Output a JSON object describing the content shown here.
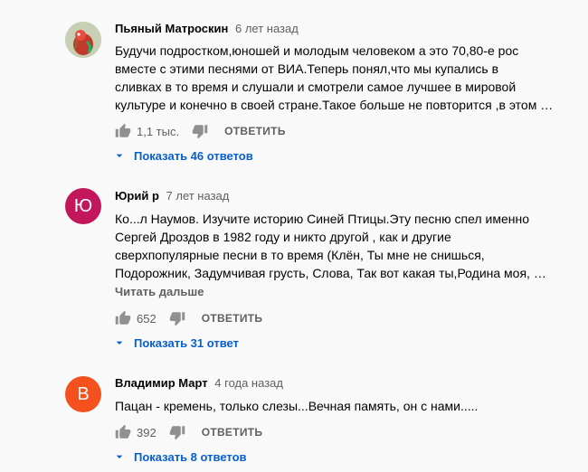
{
  "comments": [
    {
      "author": "Пьяный Матроскин",
      "time": "6 лет назад",
      "avatar_letter": "",
      "avatar_color": "#c9d2b8",
      "text": "Будучи подростком,юношей и молодым человеком а это 70,80-е рос\nвместе с этими песнями от ВИА.Теперь понял,что мы купались в\nсливках в то время и слушали и смотрели самое лучшее в мировой\nкультуре и конечно в своей стране.Такое больше не повторится ,в этом …",
      "read_more": "",
      "likes": "1,1 тыс.",
      "reply_label": "ОТВЕТИТЬ",
      "replies_label": "Показать 46 ответов"
    },
    {
      "author": "Юрий р",
      "time": "7 лет назад",
      "avatar_letter": "Ю",
      "avatar_color": "#c2185b",
      "text": "Ко...л Наумов. Изучите историю Синей Птицы.Эту песню спел именно\nСергей Дроздов в 1982 году и никто другой , как и другие\nсверхпопулярные песни в то время (Клён, Ты мне не снишься,\nПодорожник, Задумчивая грусть, Слова, Так вот какая ты,Родина моя, …",
      "read_more": "Читать дальше",
      "likes": "652",
      "reply_label": "ОТВЕТИТЬ",
      "replies_label": "Показать 31 ответ"
    },
    {
      "author": "Владимир Март",
      "time": "4 года назад",
      "avatar_letter": "В",
      "avatar_color": "#f4511e",
      "text": "Пацан - кремень, только слезы...Вечная память, он  с нами.....",
      "read_more": "",
      "likes": "392",
      "reply_label": "ОТВЕТИТЬ",
      "replies_label": "Показать 8 ответов"
    }
  ],
  "colors": {
    "link": "#065fd4",
    "secondary": "#606060",
    "background": "#f9f9f9"
  },
  "icons": [
    "thumb-up-icon",
    "thumb-down-icon",
    "chevron-down-icon"
  ]
}
